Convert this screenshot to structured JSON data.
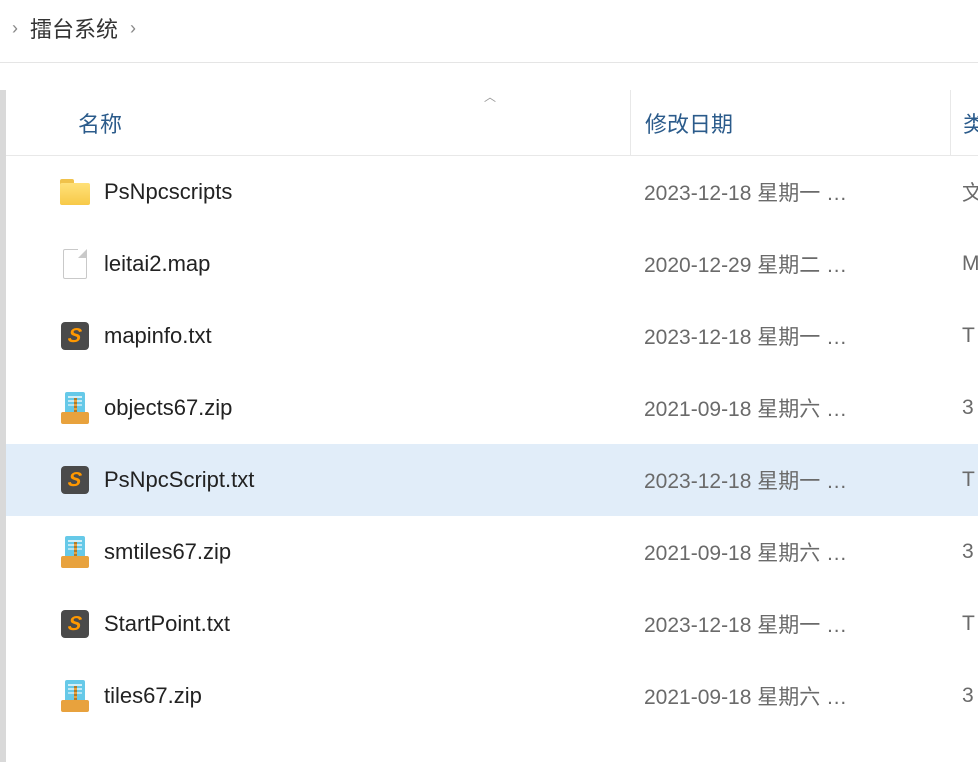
{
  "breadcrumb": {
    "segment": "擂台系统"
  },
  "columns": {
    "name": "名称",
    "date": "修改日期",
    "type": "类"
  },
  "rows": [
    {
      "icon": "folder",
      "name": "PsNpcscripts",
      "date": "2023-12-18 星期一 …",
      "type": "文",
      "selected": false
    },
    {
      "icon": "file",
      "name": "leitai2.map",
      "date": "2020-12-29 星期二 …",
      "type": "M",
      "selected": false
    },
    {
      "icon": "sublime",
      "name": "mapinfo.txt",
      "date": "2023-12-18 星期一 …",
      "type": "T",
      "selected": false
    },
    {
      "icon": "zip",
      "name": "objects67.zip",
      "date": "2021-09-18 星期六 …",
      "type": "3",
      "selected": false
    },
    {
      "icon": "sublime",
      "name": "PsNpcScript.txt",
      "date": "2023-12-18 星期一 …",
      "type": "T",
      "selected": true
    },
    {
      "icon": "zip",
      "name": "smtiles67.zip",
      "date": "2021-09-18 星期六 …",
      "type": "3",
      "selected": false
    },
    {
      "icon": "sublime",
      "name": "StartPoint.txt",
      "date": "2023-12-18 星期一 …",
      "type": "T",
      "selected": false
    },
    {
      "icon": "zip",
      "name": "tiles67.zip",
      "date": "2021-09-18 星期六 …",
      "type": "3",
      "selected": false
    }
  ]
}
